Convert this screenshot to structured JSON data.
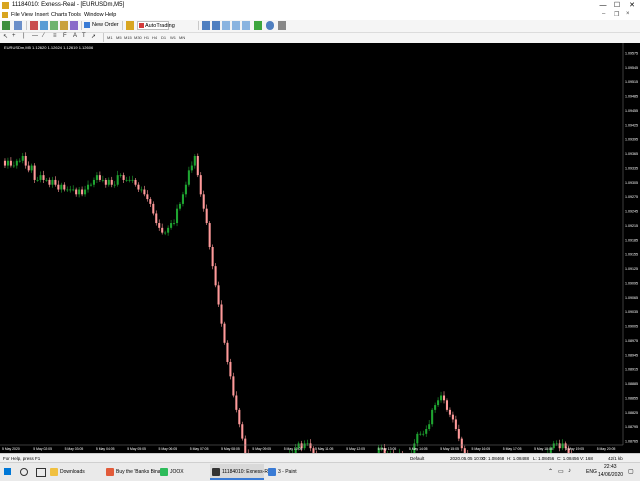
{
  "window": {
    "title": "11184010: Exness-Real - [EURUSDm,M5]",
    "min": "—",
    "max": "☐",
    "close": "✕"
  },
  "menu": [
    "File",
    "View",
    "Insert",
    "Charts",
    "Tools",
    "Window",
    "Help"
  ],
  "toolbar": {
    "new_order": "New Order",
    "autotrading": "AutoTrading",
    "timeframes": [
      "M1",
      "M5",
      "M15",
      "M30",
      "H1",
      "H4",
      "D1",
      "W1",
      "MN"
    ]
  },
  "chart_data": {
    "type": "candlestick",
    "symbol_info": "EURUSDm,M5 1.12620 1.12624 1.12619 1.12606",
    "y_labels": [
      "1.09575",
      "1.09545",
      "1.09515",
      "1.09485",
      "1.09455",
      "1.09425",
      "1.09395",
      "1.09365",
      "1.09335",
      "1.09305",
      "1.09275",
      "1.09245",
      "1.09215",
      "1.09185",
      "1.09155",
      "1.09125",
      "1.09095",
      "1.09065",
      "1.09035",
      "1.09005",
      "1.08975",
      "1.08945",
      "1.08915",
      "1.08885",
      "1.08855",
      "1.08825",
      "1.08795",
      "1.08765"
    ],
    "x_labels": [
      "5 May 2020",
      "5 May 02:05",
      "5 May 03:05",
      "5 May 04:05",
      "5 May 05:05",
      "5 May 06:05",
      "5 May 07:05",
      "5 May 08:05",
      "5 May 09:05",
      "5 May 10:05",
      "5 May 11:05",
      "5 May 12:05",
      "5 May 13:05",
      "5 May 14:05",
      "5 May 15:05",
      "5 May 16:05",
      "5 May 17:05",
      "5 May 18:05",
      "5 May 19:05",
      "5 May 20:05"
    ],
    "bull_color": "#1fa531",
    "bear_color": "#ff9a9a",
    "close_series": [
      1.0935,
      1.0934,
      1.0935,
      1.0934,
      1.0934,
      1.0935,
      1.0935,
      1.0936,
      1.0934,
      1.0933,
      1.0934,
      1.0931,
      1.0931,
      1.0932,
      1.0931,
      1.0931,
      1.093,
      1.0931,
      1.093,
      1.0929,
      1.093,
      1.0929,
      1.0929,
      1.0929,
      1.0929,
      1.0928,
      1.0929,
      1.0928,
      1.0929,
      1.093,
      1.093,
      1.0931,
      1.0932,
      1.0931,
      1.0931,
      1.093,
      1.0931,
      1.093,
      1.093,
      1.0932,
      1.0932,
      1.0931,
      1.0931,
      1.0931,
      1.0931,
      1.093,
      1.0929,
      1.0929,
      1.0928,
      1.0927,
      1.0926,
      1.0924,
      1.0922,
      1.0921,
      1.092,
      1.092,
      1.0921,
      1.0922,
      1.0922,
      1.0925,
      1.0926,
      1.0928,
      1.093,
      1.0933,
      1.0934,
      1.0936,
      1.0932,
      1.0928,
      1.0925,
      1.0922,
      1.0917,
      1.0913,
      1.0909,
      1.0905,
      1.0901,
      1.0897,
      1.0893,
      1.089,
      1.0886,
      1.0883,
      1.088,
      1.0877,
      1.0874,
      1.0872,
      1.087,
      1.0869,
      1.0868,
      1.0867,
      1.0867,
      1.0868,
      1.0869,
      1.0869,
      1.0868,
      1.0869,
      1.087,
      1.0871,
      1.0873,
      1.0874,
      1.0874,
      1.0875,
      1.0876,
      1.0875,
      1.0876,
      1.0876,
      1.0875,
      1.0874,
      1.0873,
      1.0871,
      1.087,
      1.087,
      1.0869,
      1.0868,
      1.0868,
      1.0868,
      1.0868,
      1.0868,
      1.0868,
      1.0868,
      1.0868,
      1.0867,
      1.0868,
      1.0868,
      1.0867,
      1.0868,
      1.0869,
      1.0871,
      1.0873,
      1.0875,
      1.0875,
      1.0874,
      1.0874,
      1.0874,
      1.0873,
      1.0873,
      1.0874,
      1.0873,
      1.0873,
      1.0873,
      1.0874,
      1.0876,
      1.0878,
      1.0878,
      1.0878,
      1.0879,
      1.088,
      1.0883,
      1.0884,
      1.0885,
      1.0886,
      1.0885,
      1.0883,
      1.0882,
      1.0881,
      1.0879,
      1.0877,
      1.0875,
      1.0874,
      1.0873,
      1.0872,
      1.0871,
      1.0871,
      1.087,
      1.087,
      1.087,
      1.087,
      1.087,
      1.087,
      1.0871,
      1.0871,
      1.087,
      1.087,
      1.087,
      1.087,
      1.0869,
      1.0869,
      1.0869,
      1.087,
      1.0869,
      1.0869,
      1.0869,
      1.087,
      1.0871,
      1.0872,
      1.0873,
      1.0874,
      1.0875,
      1.0876,
      1.0876,
      1.0875,
      1.0876,
      1.0875,
      1.0874,
      1.0873,
      1.0873,
      1.0872,
      1.0872,
      1.0873,
      1.0873,
      1.0873,
      1.0873,
      1.0872,
      1.0872,
      1.0871,
      1.0871,
      1.087,
      1.087,
      1.087,
      1.087,
      1.087
    ]
  },
  "status": {
    "help": "For Help, press F1",
    "profile": "Default",
    "time": "2020.05.05 10:00",
    "open": "O: 1.08468",
    "high": "H: 1.08488",
    "low": "L: 1.08456",
    "close": "C: 1.08456",
    "volume": "V: 168",
    "traffic": "42/1 kb"
  },
  "taskbar": {
    "apps": [
      {
        "label": "Downloads",
        "color": "#f0c040"
      },
      {
        "label": "Buy the 'Banks Bina...",
        "color": "#e25b3a"
      },
      {
        "label": "JOOX",
        "color": "#2dbb5a"
      },
      {
        "label": "11184010: Exness-R...",
        "color": "#333333"
      },
      {
        "label": "3 - Paint",
        "color": "#3a7bd5"
      }
    ],
    "lang": "ENG",
    "time": "22:43",
    "date": "14/06/2020"
  }
}
